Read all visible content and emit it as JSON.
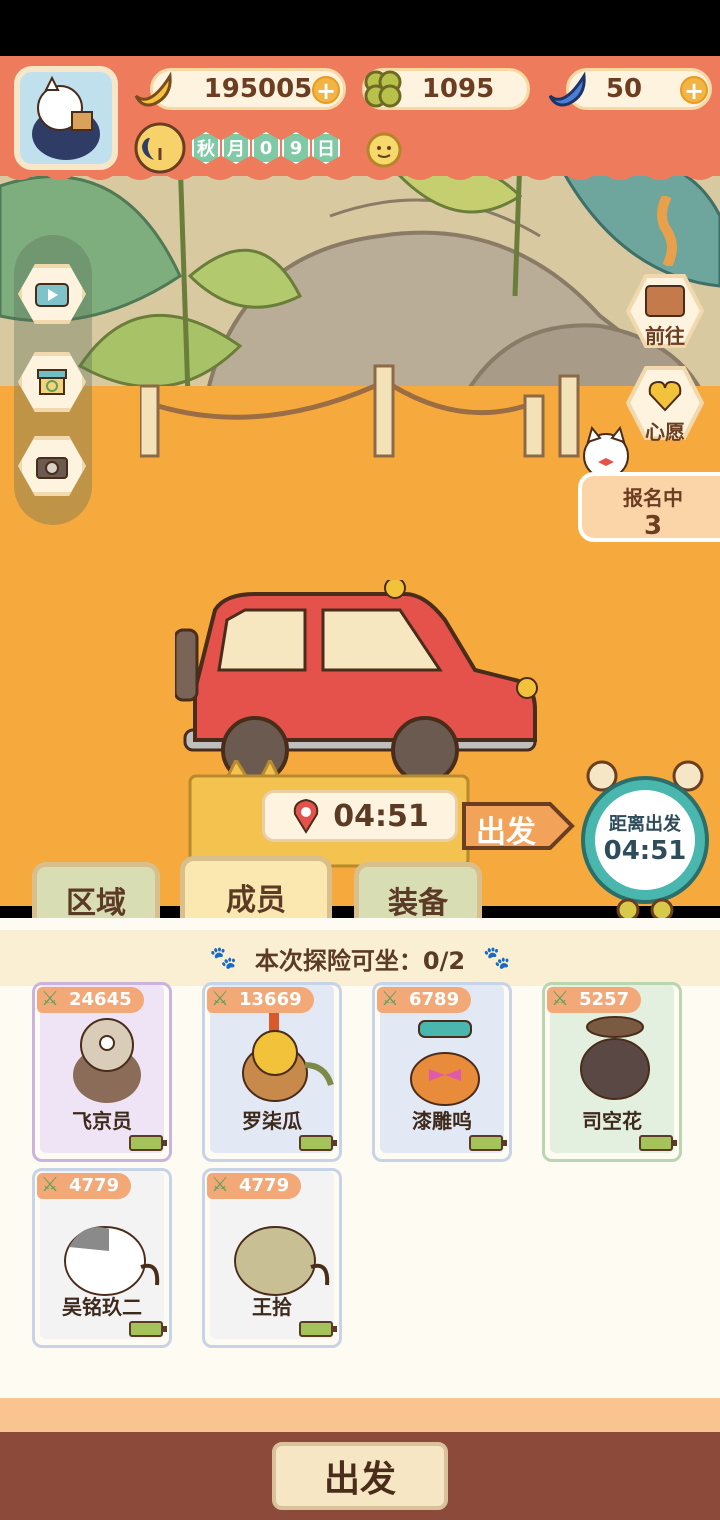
{
  "resources": {
    "banana_amount": "195005",
    "clover_amount": "1095",
    "blue_banana_amount": "50"
  },
  "date": {
    "chars": [
      "秋",
      "月",
      "0",
      "9",
      "日"
    ]
  },
  "right_menu": {
    "goto_label": "前往",
    "wish_label": "心愿"
  },
  "signup": {
    "label": "报名中",
    "count": "3"
  },
  "departure": {
    "timer": "04:51",
    "go_sign_label": "出发",
    "clock_label": "距离出发",
    "clock_time": "04:51"
  },
  "tabs": [
    {
      "label": "区域"
    },
    {
      "label": "成员"
    },
    {
      "label": "装备"
    }
  ],
  "seat_info": "本次探险可坐：0/2",
  "members": [
    {
      "power": "24645",
      "name": "飞京员"
    },
    {
      "power": "13669",
      "name": "罗柒瓜"
    },
    {
      "power": "6789",
      "name": "漆雕呜"
    },
    {
      "power": "5257",
      "name": "司空花"
    },
    {
      "power": "4779",
      "name": "吴铭玖二"
    },
    {
      "power": "4779",
      "name": "王拾"
    }
  ],
  "bottom": {
    "go_button_label": "出发"
  },
  "colors": {
    "header": "#ee7b5c",
    "ground": "#f6aa3d",
    "accent_teal": "#49b7ad",
    "car_red": "#e4524b"
  }
}
